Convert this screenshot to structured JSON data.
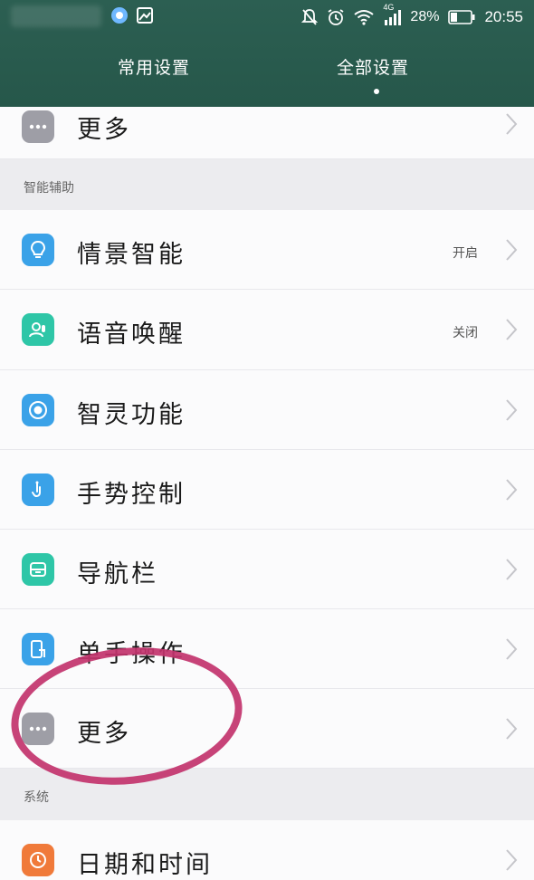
{
  "status_bar": {
    "battery": "28%",
    "time": "20:55",
    "network": "4G"
  },
  "tabs": [
    {
      "label": "常用设置",
      "active": false
    },
    {
      "label": "全部设置",
      "active": true
    }
  ],
  "rows": [
    {
      "label": "更多",
      "value": "",
      "icon": "more-icon",
      "color": "#9e9ea6"
    },
    {
      "label": "情景智能",
      "value": "开启",
      "icon": "lightbulb-icon",
      "color": "#3aa2e8"
    },
    {
      "label": "语音唤醒",
      "value": "关闭",
      "icon": "voice-wake-icon",
      "color": "#2ec6a7"
    },
    {
      "label": "智灵功能",
      "value": "",
      "icon": "smart-assistant-icon",
      "color": "#3aa2e8"
    },
    {
      "label": "手势控制",
      "value": "",
      "icon": "gesture-icon",
      "color": "#3aa2e8"
    },
    {
      "label": "导航栏",
      "value": "",
      "icon": "navigation-bar-icon",
      "color": "#2ec6a7"
    },
    {
      "label": "单手操作",
      "value": "",
      "icon": "one-hand-icon",
      "color": "#3aa2e8"
    },
    {
      "label": "更多",
      "value": "",
      "icon": "more-icon",
      "color": "#9e9ea6"
    },
    {
      "label": "日期和时间",
      "value": "",
      "icon": "clock-icon",
      "color": "#f07a3a"
    }
  ],
  "sections": [
    {
      "title": "智能辅助"
    },
    {
      "title": "系统"
    }
  ],
  "colors": {
    "header_bg": "#2c5f52",
    "annotation": "#c2336d"
  }
}
